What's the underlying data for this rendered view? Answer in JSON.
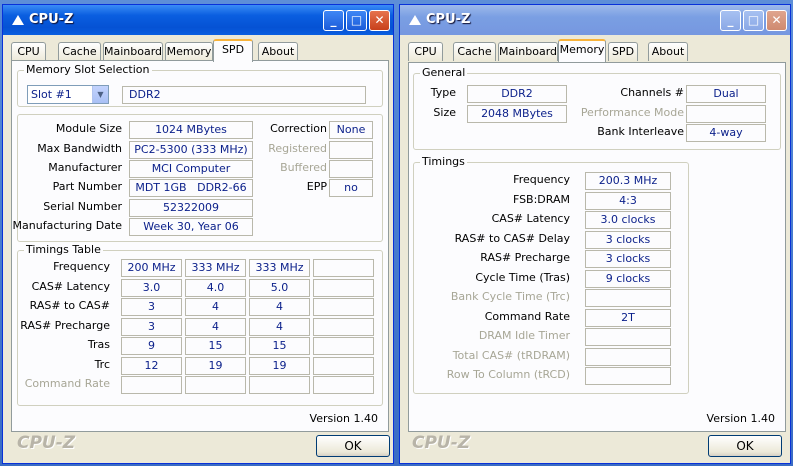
{
  "left": {
    "title": "CPU-Z",
    "tabs": [
      "CPU",
      "Cache",
      "Mainboard",
      "Memory",
      "SPD",
      "About"
    ],
    "active_tab": "SPD",
    "slot_group_label": "Memory Slot Selection",
    "slot_selected": "Slot #1",
    "slot_type": "DDR2",
    "info": {
      "module_size_label": "Module Size",
      "module_size": "1024 MBytes",
      "max_bw_label": "Max Bandwidth",
      "max_bw": "PC2-5300 (333 MHz)",
      "manufacturer_label": "Manufacturer",
      "manufacturer": "MCI Computer",
      "part_label": "Part Number",
      "part1": "MDT 1GB",
      "part2": "DDR2-66",
      "serial_label": "Serial Number",
      "serial": "52322009",
      "mfg_date_label": "Manufacturing Date",
      "mfg_date": "Week 30, Year 06",
      "correction_label": "Correction",
      "correction": "None",
      "registered_label": "Registered",
      "buffered_label": "Buffered",
      "epp_label": "EPP",
      "epp": "no"
    },
    "timings_label": "Timings Table",
    "timings_rows": [
      {
        "label": "Frequency",
        "values": [
          "200 MHz",
          "333 MHz",
          "333 MHz",
          ""
        ],
        "disabled": false
      },
      {
        "label": "CAS# Latency",
        "values": [
          "3.0",
          "4.0",
          "5.0",
          ""
        ],
        "disabled": false
      },
      {
        "label": "RAS# to CAS#",
        "values": [
          "3",
          "4",
          "4",
          ""
        ],
        "disabled": false
      },
      {
        "label": "RAS# Precharge",
        "values": [
          "3",
          "4",
          "4",
          ""
        ],
        "disabled": false
      },
      {
        "label": "Tras",
        "values": [
          "9",
          "15",
          "15",
          ""
        ],
        "disabled": false
      },
      {
        "label": "Trc",
        "values": [
          "12",
          "19",
          "19",
          ""
        ],
        "disabled": false
      },
      {
        "label": "Command Rate",
        "values": [
          "",
          "",
          "",
          ""
        ],
        "disabled": true
      }
    ],
    "version": "Version 1.40",
    "brand": "CPU-Z",
    "ok": "OK"
  },
  "right": {
    "title": "CPU-Z",
    "tabs": [
      "CPU",
      "Cache",
      "Mainboard",
      "Memory",
      "SPD",
      "About"
    ],
    "active_tab": "Memory",
    "general_label": "General",
    "type_label": "Type",
    "type": "DDR2",
    "size_label": "Size",
    "size": "2048 MBytes",
    "channels_label": "Channels #",
    "channels": "Dual",
    "perf_mode_label": "Performance Mode",
    "perf_mode": "",
    "bank_interleave_label": "Bank Interleave",
    "bank_interleave": "4-way",
    "timings_label": "Timings",
    "timings": [
      {
        "label": "Frequency",
        "value": "200.3 MHz",
        "disabled": false
      },
      {
        "label": "FSB:DRAM",
        "value": "4:3",
        "disabled": false
      },
      {
        "label": "CAS# Latency",
        "value": "3.0 clocks",
        "disabled": false
      },
      {
        "label": "RAS# to CAS# Delay",
        "value": "3 clocks",
        "disabled": false
      },
      {
        "label": "RAS# Precharge",
        "value": "3 clocks",
        "disabled": false
      },
      {
        "label": "Cycle Time (Tras)",
        "value": "9 clocks",
        "disabled": false
      },
      {
        "label": "Bank Cycle Time (Trc)",
        "value": "",
        "disabled": true
      },
      {
        "label": "Command Rate",
        "value": "2T",
        "disabled": false
      },
      {
        "label": "DRAM Idle Timer",
        "value": "",
        "disabled": true
      },
      {
        "label": "Total CAS# (tRDRAM)",
        "value": "",
        "disabled": true
      },
      {
        "label": "Row To Column (tRCD)",
        "value": "",
        "disabled": true
      }
    ],
    "version": "Version 1.40",
    "brand": "CPU-Z",
    "ok": "OK"
  }
}
